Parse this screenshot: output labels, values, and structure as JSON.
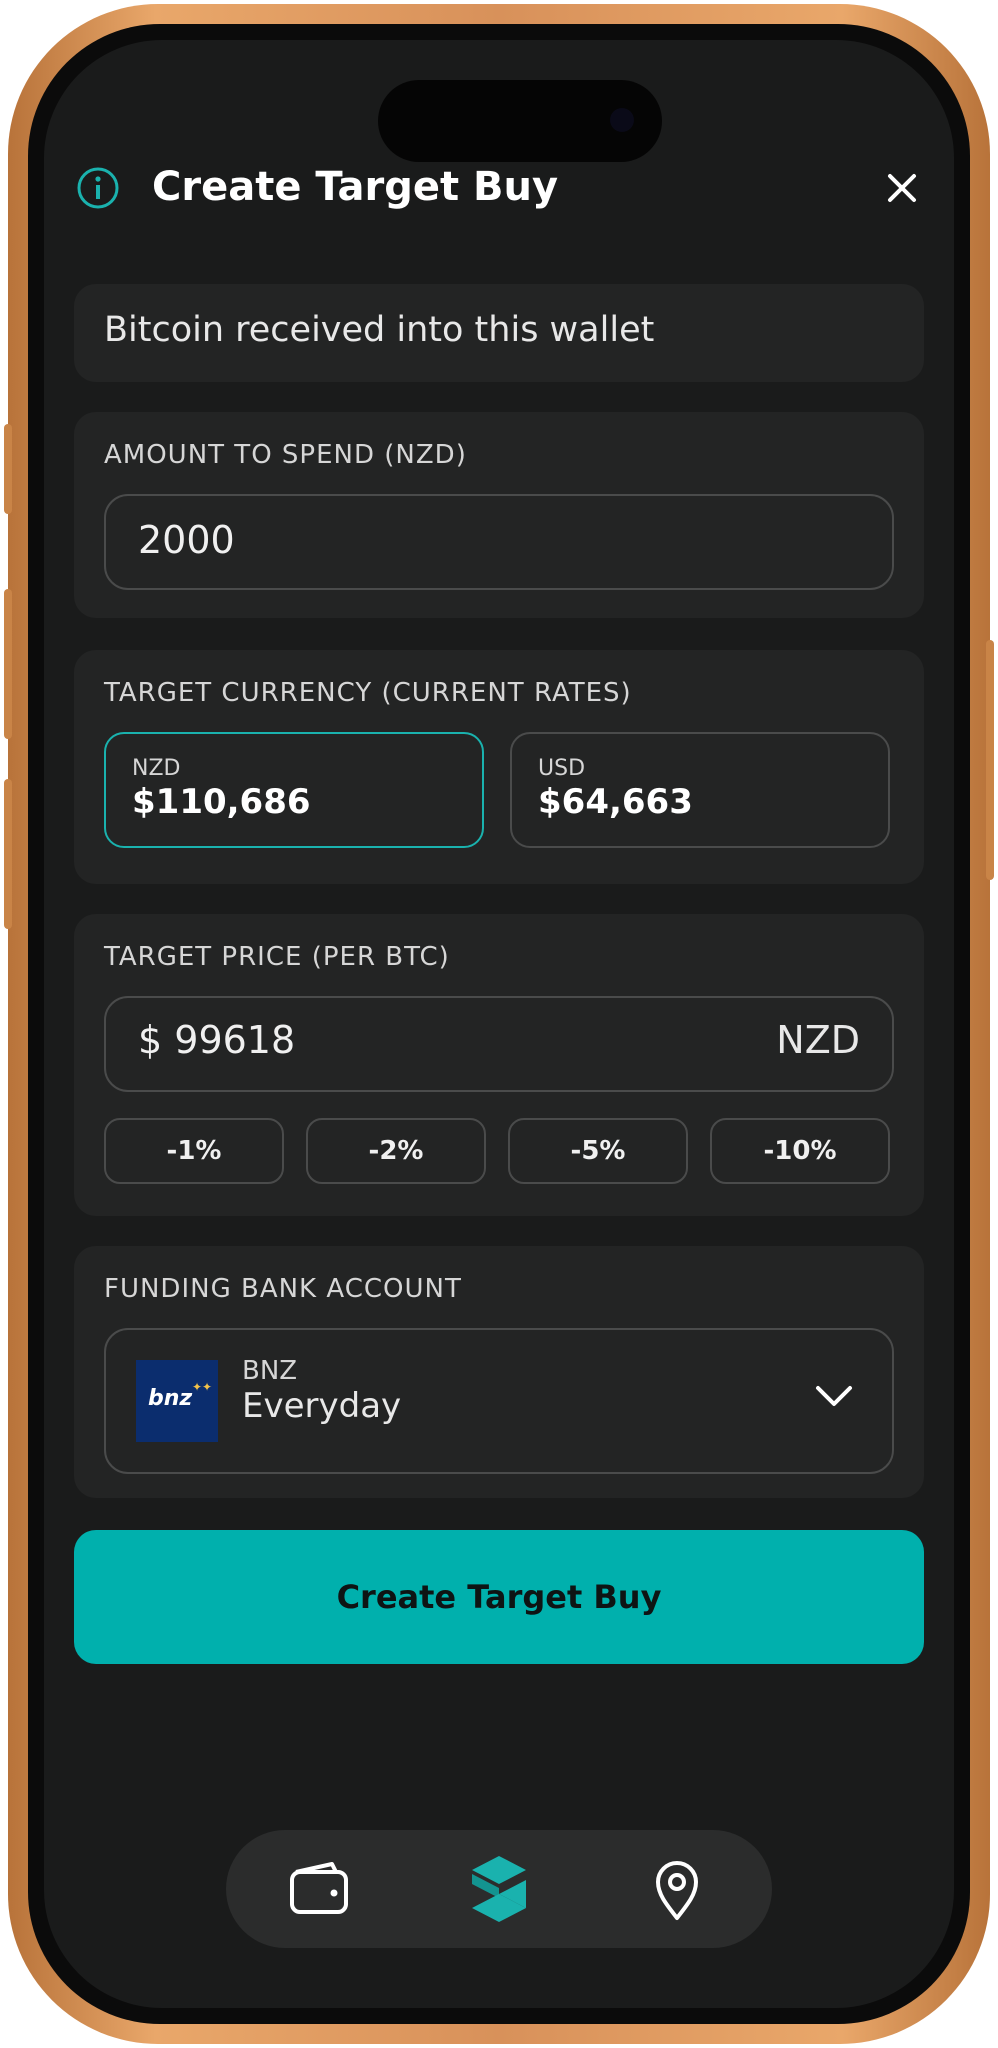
{
  "header": {
    "title": "Create Target Buy"
  },
  "wallet": {
    "text": "Bitcoin received into this wallet"
  },
  "amount": {
    "label": "AMOUNT TO SPEND (NZD)",
    "value": "2000"
  },
  "target_currency": {
    "label": "TARGET CURRENCY (CURRENT RATES)",
    "options": [
      {
        "code": "NZD",
        "rate": "$110,686",
        "selected": true
      },
      {
        "code": "USD",
        "rate": "$64,663",
        "selected": false
      }
    ]
  },
  "target_price": {
    "label": "TARGET PRICE (PER BTC)",
    "currency_symbol": "$",
    "value": "99618",
    "currency": "NZD",
    "adjustments": [
      "-1%",
      "-2%",
      "-5%",
      "-10%"
    ]
  },
  "funding": {
    "label": "FUNDING BANK ACCOUNT",
    "logo_text": "bnz",
    "bank": "BNZ",
    "account": "Everyday"
  },
  "cta": {
    "label": "Create Target Buy"
  },
  "colors": {
    "accent": "#00B0AD",
    "background": "#1A1B1B",
    "card": "#232424"
  },
  "tabs": [
    {
      "icon": "wallet-icon",
      "active": false
    },
    {
      "icon": "brand-logo-icon",
      "active": true
    },
    {
      "icon": "location-pin-icon",
      "active": false
    }
  ]
}
